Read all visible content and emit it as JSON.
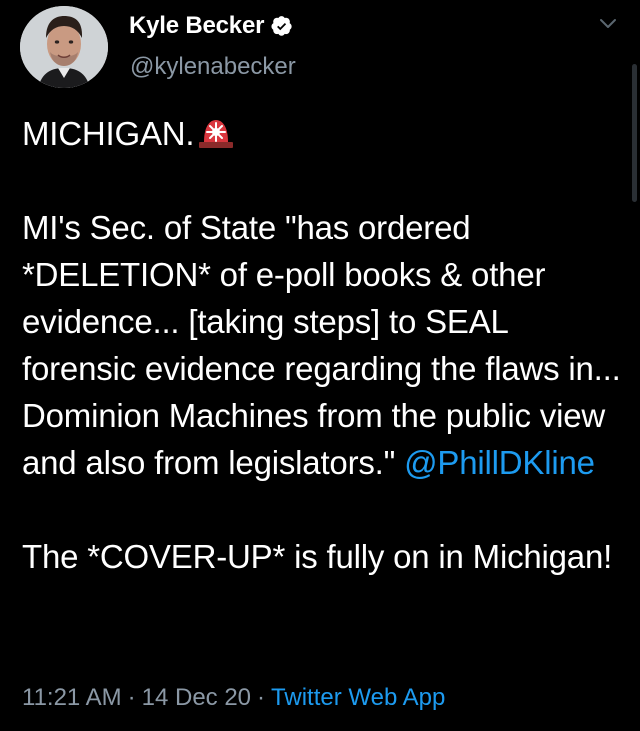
{
  "author": {
    "display_name": "Kyle Becker",
    "handle": "@kylenabecker",
    "avatar_icon": "avatar-photo",
    "verified_icon": "verified-badge-icon"
  },
  "header": {
    "menu_icon": "chevron-down-icon"
  },
  "tweet": {
    "line1_text": "MICHIGAN.",
    "line1_emoji": "rotating-light-siren-icon",
    "para2_text": "MI's Sec. of State \"has ordered *DELETION* of e-poll books & other evidence... [taking steps] to SEAL forensic evidence regarding the flaws in... Dominion Machines from the public view and also from legislators.\" ",
    "mention": "@PhillDKline",
    "para3_text": "The *COVER-UP* is fully on in Michigan!"
  },
  "meta": {
    "time": "11:21 AM",
    "separator": "·",
    "date": "14 Dec 20",
    "source": "Twitter Web App"
  },
  "colors": {
    "background": "#000000",
    "text": "#ffffff",
    "secondary": "#8b98a5",
    "accent": "#1d9bf0"
  }
}
